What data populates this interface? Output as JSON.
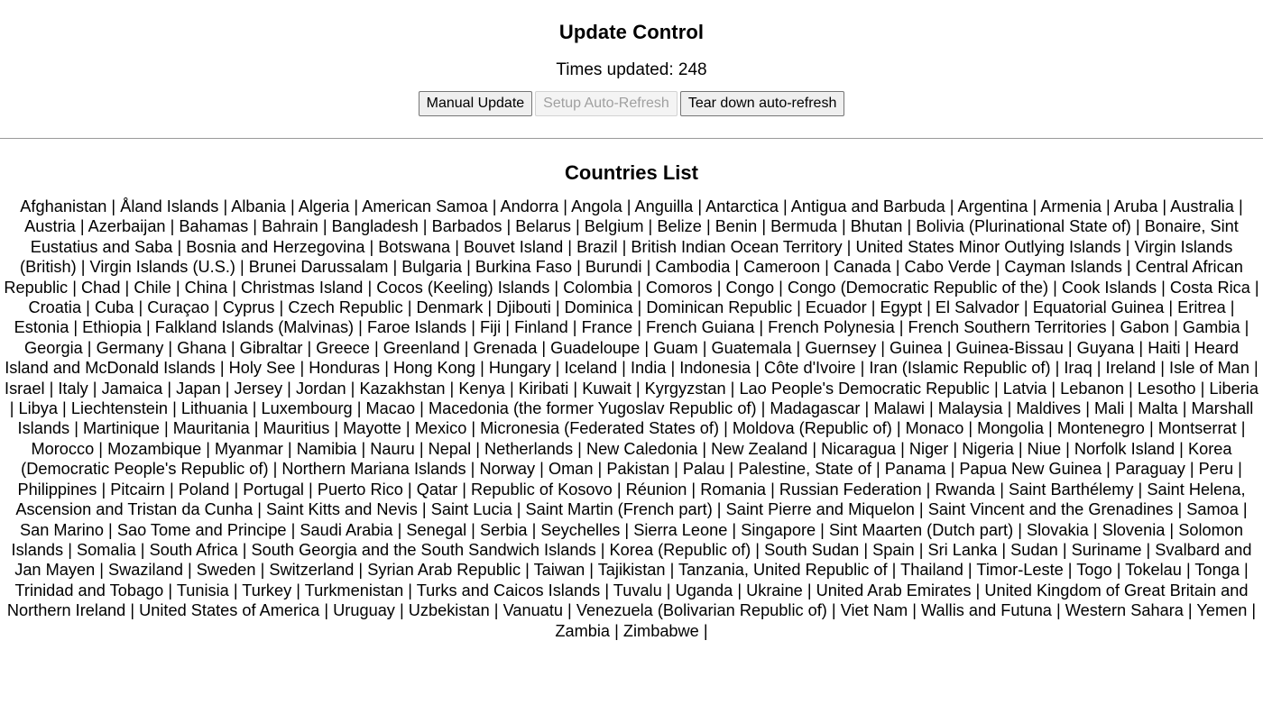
{
  "update_control": {
    "title": "Update Control",
    "counter_label": "Times updated: ",
    "counter_value": "248",
    "buttons": {
      "manual_update": "Manual Update",
      "setup_auto_refresh": "Setup Auto-Refresh",
      "tear_down_auto_refresh": "Tear down auto-refresh"
    }
  },
  "countries_list": {
    "title": "Countries List",
    "separator": " | ",
    "items": [
      "Afghanistan",
      "Åland Islands",
      "Albania",
      "Algeria",
      "American Samoa",
      "Andorra",
      "Angola",
      "Anguilla",
      "Antarctica",
      "Antigua and Barbuda",
      "Argentina",
      "Armenia",
      "Aruba",
      "Australia",
      "Austria",
      "Azerbaijan",
      "Bahamas",
      "Bahrain",
      "Bangladesh",
      "Barbados",
      "Belarus",
      "Belgium",
      "Belize",
      "Benin",
      "Bermuda",
      "Bhutan",
      "Bolivia (Plurinational State of)",
      "Bonaire, Sint Eustatius and Saba",
      "Bosnia and Herzegovina",
      "Botswana",
      "Bouvet Island",
      "Brazil",
      "British Indian Ocean Territory",
      "United States Minor Outlying Islands",
      "Virgin Islands (British)",
      "Virgin Islands (U.S.)",
      "Brunei Darussalam",
      "Bulgaria",
      "Burkina Faso",
      "Burundi",
      "Cambodia",
      "Cameroon",
      "Canada",
      "Cabo Verde",
      "Cayman Islands",
      "Central African Republic",
      "Chad",
      "Chile",
      "China",
      "Christmas Island",
      "Cocos (Keeling) Islands",
      "Colombia",
      "Comoros",
      "Congo",
      "Congo (Democratic Republic of the)",
      "Cook Islands",
      "Costa Rica",
      "Croatia",
      "Cuba",
      "Curaçao",
      "Cyprus",
      "Czech Republic",
      "Denmark",
      "Djibouti",
      "Dominica",
      "Dominican Republic",
      "Ecuador",
      "Egypt",
      "El Salvador",
      "Equatorial Guinea",
      "Eritrea",
      "Estonia",
      "Ethiopia",
      "Falkland Islands (Malvinas)",
      "Faroe Islands",
      "Fiji",
      "Finland",
      "France",
      "French Guiana",
      "French Polynesia",
      "French Southern Territories",
      "Gabon",
      "Gambia",
      "Georgia",
      "Germany",
      "Ghana",
      "Gibraltar",
      "Greece",
      "Greenland",
      "Grenada",
      "Guadeloupe",
      "Guam",
      "Guatemala",
      "Guernsey",
      "Guinea",
      "Guinea-Bissau",
      "Guyana",
      "Haiti",
      "Heard Island and McDonald Islands",
      "Holy See",
      "Honduras",
      "Hong Kong",
      "Hungary",
      "Iceland",
      "India",
      "Indonesia",
      "Côte d'Ivoire",
      "Iran (Islamic Republic of)",
      "Iraq",
      "Ireland",
      "Isle of Man",
      "Israel",
      "Italy",
      "Jamaica",
      "Japan",
      "Jersey",
      "Jordan",
      "Kazakhstan",
      "Kenya",
      "Kiribati",
      "Kuwait",
      "Kyrgyzstan",
      "Lao People's Democratic Republic",
      "Latvia",
      "Lebanon",
      "Lesotho",
      "Liberia",
      "Libya",
      "Liechtenstein",
      "Lithuania",
      "Luxembourg",
      "Macao",
      "Macedonia (the former Yugoslav Republic of)",
      "Madagascar",
      "Malawi",
      "Malaysia",
      "Maldives",
      "Mali",
      "Malta",
      "Marshall Islands",
      "Martinique",
      "Mauritania",
      "Mauritius",
      "Mayotte",
      "Mexico",
      "Micronesia (Federated States of)",
      "Moldova (Republic of)",
      "Monaco",
      "Mongolia",
      "Montenegro",
      "Montserrat",
      "Morocco",
      "Mozambique",
      "Myanmar",
      "Namibia",
      "Nauru",
      "Nepal",
      "Netherlands",
      "New Caledonia",
      "New Zealand",
      "Nicaragua",
      "Niger",
      "Nigeria",
      "Niue",
      "Norfolk Island",
      "Korea (Democratic People's Republic of)",
      "Northern Mariana Islands",
      "Norway",
      "Oman",
      "Pakistan",
      "Palau",
      "Palestine, State of",
      "Panama",
      "Papua New Guinea",
      "Paraguay",
      "Peru",
      "Philippines",
      "Pitcairn",
      "Poland",
      "Portugal",
      "Puerto Rico",
      "Qatar",
      "Republic of Kosovo",
      "Réunion",
      "Romania",
      "Russian Federation",
      "Rwanda",
      "Saint Barthélemy",
      "Saint Helena, Ascension and Tristan da Cunha",
      "Saint Kitts and Nevis",
      "Saint Lucia",
      "Saint Martin (French part)",
      "Saint Pierre and Miquelon",
      "Saint Vincent and the Grenadines",
      "Samoa",
      "San Marino",
      "Sao Tome and Principe",
      "Saudi Arabia",
      "Senegal",
      "Serbia",
      "Seychelles",
      "Sierra Leone",
      "Singapore",
      "Sint Maarten (Dutch part)",
      "Slovakia",
      "Slovenia",
      "Solomon Islands",
      "Somalia",
      "South Africa",
      "South Georgia and the South Sandwich Islands",
      "Korea (Republic of)",
      "South Sudan",
      "Spain",
      "Sri Lanka",
      "Sudan",
      "Suriname",
      "Svalbard and Jan Mayen",
      "Swaziland",
      "Sweden",
      "Switzerland",
      "Syrian Arab Republic",
      "Taiwan",
      "Tajikistan",
      "Tanzania, United Republic of",
      "Thailand",
      "Timor-Leste",
      "Togo",
      "Tokelau",
      "Tonga",
      "Trinidad and Tobago",
      "Tunisia",
      "Turkey",
      "Turkmenistan",
      "Turks and Caicos Islands",
      "Tuvalu",
      "Uganda",
      "Ukraine",
      "United Arab Emirates",
      "United Kingdom of Great Britain and Northern Ireland",
      "United States of America",
      "Uruguay",
      "Uzbekistan",
      "Vanuatu",
      "Venezuela (Bolivarian Republic of)",
      "Viet Nam",
      "Wallis and Futuna",
      "Western Sahara",
      "Yemen",
      "Zambia",
      "Zimbabwe"
    ]
  }
}
